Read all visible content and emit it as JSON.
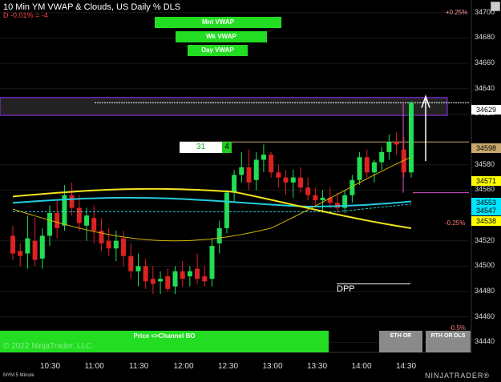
{
  "header": {
    "title": "10 Min YM VWAP & Clouds, US Daily % DLS",
    "subtitle": "D -0.01% = -4"
  },
  "vwap_buttons": [
    "Mnt VWAP",
    "Wk VWAP",
    "Day VWAP"
  ],
  "bottom": {
    "price_channel": "Price <>Channel BO",
    "copyright": "© 2022 NinjaTrader, LLC",
    "eth_or": "ETH OR",
    "rth_or": "RTH OR DLS",
    "instrument": "MYM 5 Minute",
    "brand": "NINJATRADER®"
  },
  "tick_box": {
    "left": "31",
    "right": "4"
  },
  "dpp_label": "DPP",
  "pct_labels": {
    "top": "+0.25%",
    "mid": "-0.25%",
    "low": "-0.5%"
  },
  "yaxis_ticks": [
    "34700",
    "34680",
    "34660",
    "34640",
    "34620",
    "34580",
    "34560",
    "34520",
    "34500",
    "34480",
    "34460",
    "34440"
  ],
  "xaxis_ticks": [
    "10:30",
    "11:00",
    "11:30",
    "12:00",
    "12:30",
    "13:00",
    "13:30",
    "14:00",
    "14:30"
  ],
  "price_tags": [
    {
      "text": "34629",
      "bg": "#ffffff",
      "fg": "#000000"
    },
    {
      "text": "34598",
      "bg": "#c8aa6e",
      "fg": "#000000"
    },
    {
      "text": "34571",
      "bg": "#ffff00",
      "fg": "#000000"
    },
    {
      "text": "34553",
      "bg": "#00e5ff",
      "fg": "#000000"
    },
    {
      "text": "34547",
      "bg": "#00e5ff",
      "fg": "#000000"
    },
    {
      "text": "34538",
      "bg": "#ffff00",
      "fg": "#000000"
    }
  ],
  "colors": {
    "up": "#22dd55",
    "down": "#dd2222",
    "vwap_cyan": "#22ccdd",
    "vwap_yellow": "#f2e21a",
    "sma_gold": "#d4b400",
    "zone": "#9b30ff",
    "button_green": "#22dd22",
    "grid": "#1a1a1a"
  },
  "chart_data": {
    "type": "candlestick",
    "title": "10 Min YM VWAP & Clouds, US Daily % DLS",
    "ylim": [
      34432,
      34710
    ],
    "xlabels": [
      "10:30",
      "11:00",
      "11:30",
      "12:00",
      "12:30",
      "13:00",
      "13:30",
      "14:00",
      "14:30"
    ],
    "candles": [
      [
        34524,
        34532,
        34505,
        34510
      ],
      [
        34512,
        34518,
        34500,
        34508
      ],
      [
        34510,
        34540,
        34498,
        34522
      ],
      [
        34520,
        34538,
        34500,
        34505
      ],
      [
        34506,
        34530,
        34498,
        34524
      ],
      [
        34524,
        34548,
        34516,
        34542
      ],
      [
        34542,
        34552,
        34522,
        34530
      ],
      [
        34532,
        34564,
        34528,
        34556
      ],
      [
        34556,
        34566,
        34540,
        34546
      ],
      [
        34546,
        34556,
        34528,
        34534
      ],
      [
        34532,
        34546,
        34520,
        34540
      ],
      [
        34538,
        34548,
        34518,
        34528
      ],
      [
        34528,
        34538,
        34512,
        34518
      ],
      [
        34520,
        34530,
        34508,
        34514
      ],
      [
        34514,
        34528,
        34504,
        34520
      ],
      [
        34522,
        34528,
        34500,
        34508
      ],
      [
        34508,
        34518,
        34490,
        34496
      ],
      [
        34496,
        34510,
        34484,
        34500
      ],
      [
        34500,
        34506,
        34482,
        34488
      ],
      [
        34490,
        34500,
        34478,
        34486
      ],
      [
        34488,
        34496,
        34478,
        34490
      ],
      [
        34492,
        34498,
        34480,
        34482
      ],
      [
        34484,
        34500,
        34478,
        34496
      ],
      [
        34496,
        34504,
        34484,
        34490
      ],
      [
        34492,
        34500,
        34484,
        34496
      ],
      [
        34498,
        34510,
        34486,
        34490
      ],
      [
        34492,
        34500,
        34484,
        34488
      ],
      [
        34490,
        34522,
        34484,
        34516
      ],
      [
        34518,
        34536,
        34510,
        34530
      ],
      [
        34530,
        34560,
        34526,
        34558
      ],
      [
        34558,
        34576,
        34550,
        34572
      ],
      [
        34572,
        34590,
        34566,
        34578
      ],
      [
        34578,
        34592,
        34560,
        34566
      ],
      [
        34568,
        34590,
        34560,
        34584
      ],
      [
        34584,
        34596,
        34574,
        34588
      ],
      [
        34588,
        34590,
        34570,
        34574
      ],
      [
        34574,
        34580,
        34562,
        34570
      ],
      [
        34570,
        34576,
        34556,
        34566
      ],
      [
        34566,
        34576,
        34554,
        34570
      ],
      [
        34570,
        34578,
        34558,
        34562
      ],
      [
        34562,
        34570,
        34552,
        34556
      ],
      [
        34556,
        34562,
        34548,
        34552
      ],
      [
        34552,
        34560,
        34542,
        34554
      ],
      [
        34554,
        34562,
        34546,
        34550
      ],
      [
        34550,
        34558,
        34542,
        34546
      ],
      [
        34546,
        34560,
        34542,
        34556
      ],
      [
        34556,
        34572,
        34550,
        34568
      ],
      [
        34568,
        34590,
        34564,
        34586
      ],
      [
        34586,
        34592,
        34570,
        34574
      ],
      [
        34574,
        34584,
        34566,
        34582
      ],
      [
        34582,
        34594,
        34576,
        34590
      ],
      [
        34590,
        34604,
        34584,
        34598
      ],
      [
        34598,
        34606,
        34588,
        34596
      ],
      [
        34592,
        34602,
        34570,
        34574
      ],
      [
        34574,
        34630,
        34570,
        34629
      ]
    ]
  }
}
